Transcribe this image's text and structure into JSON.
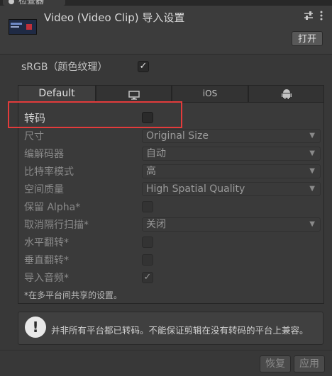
{
  "top_tab": {
    "label": "检查器"
  },
  "header": {
    "title": "Video (Video Clip) 导入设置",
    "open_button": "打开",
    "icons": [
      "preset-icon",
      "more-icon"
    ]
  },
  "srgb": {
    "label": "sRGB（颜色纹理）",
    "checked": true
  },
  "platform_tabs": [
    {
      "label": "Default",
      "active": true
    },
    {
      "label": "",
      "icon": "monitor-icon"
    },
    {
      "label": "iOS"
    },
    {
      "label": "",
      "icon": "android-icon"
    }
  ],
  "settings": {
    "transcode": {
      "label": "转码",
      "checked": false
    },
    "size": {
      "label": "尺寸",
      "value": "Original Size"
    },
    "codec": {
      "label": "编解码器",
      "value": "自动"
    },
    "bitrate_mode": {
      "label": "比特率模式",
      "value": "高"
    },
    "spatial_quality": {
      "label": "空间质量",
      "value": "High Spatial Quality"
    },
    "keep_alpha": {
      "label": "保留 Alpha*",
      "checked": false
    },
    "deinterlace": {
      "label": "取消隔行扫描*",
      "value": "关闭"
    },
    "flip_h": {
      "label": "水平翻转*",
      "checked": false
    },
    "flip_v": {
      "label": "垂直翻转*",
      "checked": false
    },
    "import_audio": {
      "label": "导入音频*",
      "checked": true
    }
  },
  "shared_note": "*在多平台间共享的设置。",
  "info": "并非所有平台都已转码。不能保证剪辑在没有转码的平台上兼容。",
  "footer": {
    "revert": "恢复",
    "apply": "应用"
  },
  "colors": {
    "background": "#383838",
    "highlight": "#e33b3b"
  }
}
